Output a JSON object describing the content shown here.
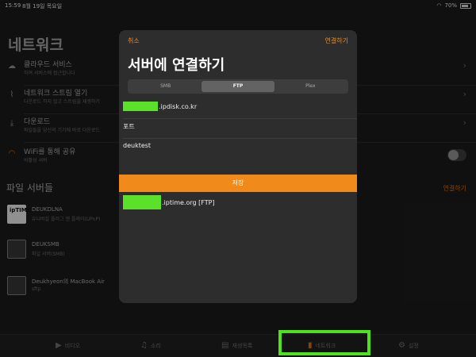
{
  "status": {
    "time": "15:59",
    "date": "8월 19일 목요일",
    "battery": "70%"
  },
  "background": {
    "title": "네트워크",
    "rows": [
      {
        "icon": "cloud-icon",
        "label": "클라우드 서비스",
        "sub": "하여 서비스에 접근합니다"
      },
      {
        "icon": "rss-icon",
        "label": "네트워크 스트림 열기",
        "sub": "다운로드 하지 않고 스트림을 재생하기"
      },
      {
        "icon": "download-icon",
        "label": "다운로드",
        "sub": "파일들을 당신의 기기에 바로 다운로드"
      },
      {
        "icon": "wifi-icon",
        "label": "WiFi를 통해 공유",
        "sub": "비활성 서버"
      }
    ],
    "section_title": "파일 서버들",
    "connect_label": "연결하기",
    "servers": [
      {
        "name": "DEUKDLNA",
        "sub": "유니버설 플러그 앤 플레이(UPnP)",
        "logo": "ipTIME"
      },
      {
        "name": "DEUKSMB",
        "sub": "파일 서버(SMB)"
      },
      {
        "name": "Deukhyeon의 MacBook Air",
        "sub": "sftp"
      }
    ]
  },
  "modal": {
    "cancel": "취소",
    "connect": "연결하기",
    "title": "서버에 연결하기",
    "protocols": [
      "SMB",
      "FTP",
      "Plex"
    ],
    "selected_protocol": "FTP",
    "server_value": ".ipdisk.co.kr",
    "port_label": "포트",
    "username_value": "deuktest",
    "save_label": "저장",
    "saved_entry": ".iptime.org [FTP]"
  },
  "tabs": [
    {
      "label": "비디오",
      "icon": "video-icon"
    },
    {
      "label": "소리",
      "icon": "music-icon"
    },
    {
      "label": "재생목록",
      "icon": "playlist-icon"
    },
    {
      "label": "네트워크",
      "icon": "network-icon"
    },
    {
      "label": "설정",
      "icon": "gear-icon"
    }
  ],
  "colors": {
    "accent": "#f08a1b",
    "highlight": "#4fe01f",
    "redaction": "#5ce12a"
  }
}
